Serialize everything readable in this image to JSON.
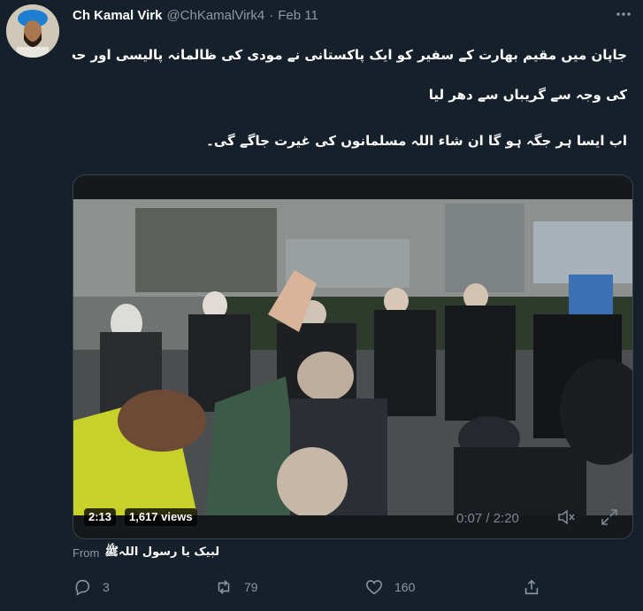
{
  "tweet": {
    "author_name": "Ch Kamal Virk",
    "handle": "@ChKamalVirk4",
    "separator": "·",
    "date": "Feb 11",
    "more_icon": "more-horizontal-icon",
    "text_lines": [
      "جاپان میں مقیم بھارت کے سفیر کو ایک پاکستانی نے مودی کی ظالمانہ پالیسی اور حجاب کے خلاف بنائے جانے والے قانون",
      "کی وجہ سے گریباں سے دھر لیا",
      "اب ایسا ہر جگہ ہو گا ان شاء اللہ مسلمانوں کی غیرت جاگے گی۔"
    ]
  },
  "video": {
    "duration_badge": "2:13",
    "views_badge": "1,617 views",
    "progress_time": "0:07 / 2:20",
    "mute_icon": "volume-mute-icon",
    "fullscreen_icon": "fullscreen-icon"
  },
  "source": {
    "label": "From",
    "name": "لبیک یا رسول اللہﷺ"
  },
  "actions": {
    "reply_count": "3",
    "retweet_count": "79",
    "like_count": "160",
    "reply_icon": "reply-icon",
    "retweet_icon": "retweet-icon",
    "like_icon": "heart-icon",
    "share_icon": "share-icon"
  },
  "colors": {
    "background": "#15202b",
    "secondary_text": "#8b98a5",
    "primary_text": "#ffffff"
  }
}
